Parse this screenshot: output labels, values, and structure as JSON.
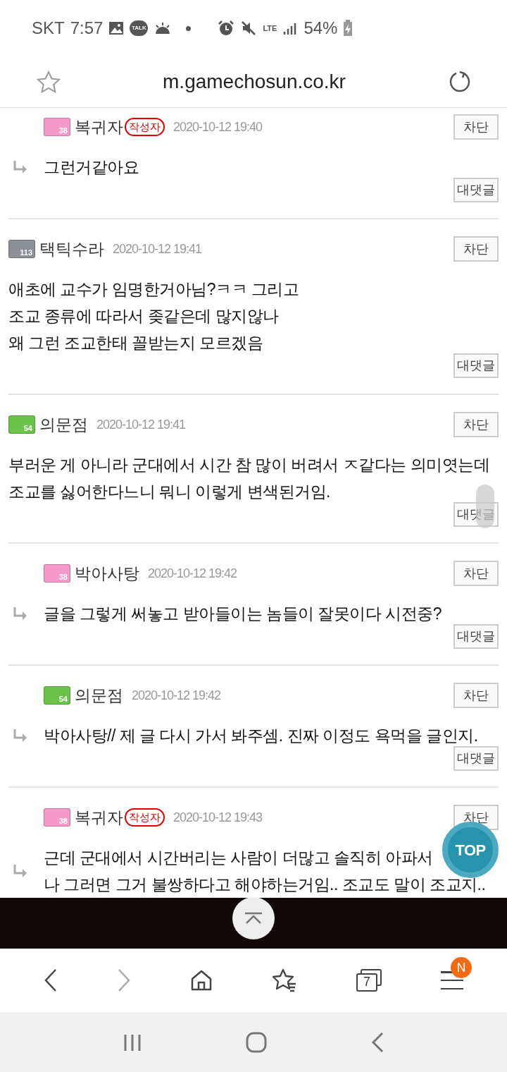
{
  "status_bar": {
    "carrier": "SKT",
    "time": "7:57",
    "notification_talk": "TALK",
    "network": "LTE",
    "battery": "54%"
  },
  "address_bar": {
    "url": "m.gamechosun.co.kr"
  },
  "comments": [
    {
      "reply": true,
      "level_badge": {
        "text": "38",
        "color": "#f39ac8"
      },
      "author": "복귀자",
      "author_tag": "작성자",
      "date": "2020-10-12 19:40",
      "lines": [
        "그런거같아요"
      ],
      "block": "차단",
      "reply_button": "대댓글"
    },
    {
      "reply": false,
      "level_badge": {
        "text": "113",
        "color": "#8a9096"
      },
      "author": "택틱수라",
      "date": "2020-10-12 19:41",
      "lines": [
        "애초에 교수가 임명한거아님?ㅋㅋ 그리고",
        "조교 종류에 따라서 좆같은데 많지않나",
        "왜 그런 조교한태 꼴받는지 모르겠음"
      ],
      "block": "차단",
      "reply_button": "대댓글"
    },
    {
      "reply": false,
      "level_badge": {
        "text": "54",
        "color": "#6cc24a"
      },
      "author": "의문점",
      "date": "2020-10-12 19:41",
      "lines": [
        "부러운 게 아니라 군대에서 시간 참 많이 버려서 ㅈ같다는 의미엿는데",
        "조교를 싫어한다느니 뭐니 이렇게 변색된거임."
      ],
      "block": "차단",
      "reply_button": "대댓글"
    },
    {
      "reply": true,
      "level_badge": {
        "text": "38",
        "color": "#f39ac8"
      },
      "author": "박아사탕",
      "date": "2020-10-12 19:42",
      "lines": [
        "글을 그렇게 써놓고 받아들이는 놈들이 잘못이다 시전중?"
      ],
      "block": "차단",
      "reply_button": "대댓글"
    },
    {
      "reply": true,
      "level_badge": {
        "text": "54",
        "color": "#6cc24a"
      },
      "author": "의문점",
      "date": "2020-10-12 19:42",
      "lines": [
        "박아사탕// 제 글 다시 가서 봐주셈. 진짜 이정도 욕먹을 글인지."
      ],
      "block": "차단",
      "reply_button": "대댓글"
    },
    {
      "reply": true,
      "level_badge": {
        "text": "38",
        "color": "#f39ac8"
      },
      "author": "복귀자",
      "author_tag": "작성자",
      "date": "2020-10-12 19:43",
      "lines": [
        "근데 군대에서 시간버리는 사람이 더많고 솔직히 아파서",
        "나 그러면 그거 불쌍하다고 해야하는거임.. 조교도 말이 조교지.."
      ],
      "block": "차단"
    }
  ],
  "top_button": "TOP",
  "browser_toolbar": {
    "tabs_count": "7",
    "menu_badge": "N"
  }
}
